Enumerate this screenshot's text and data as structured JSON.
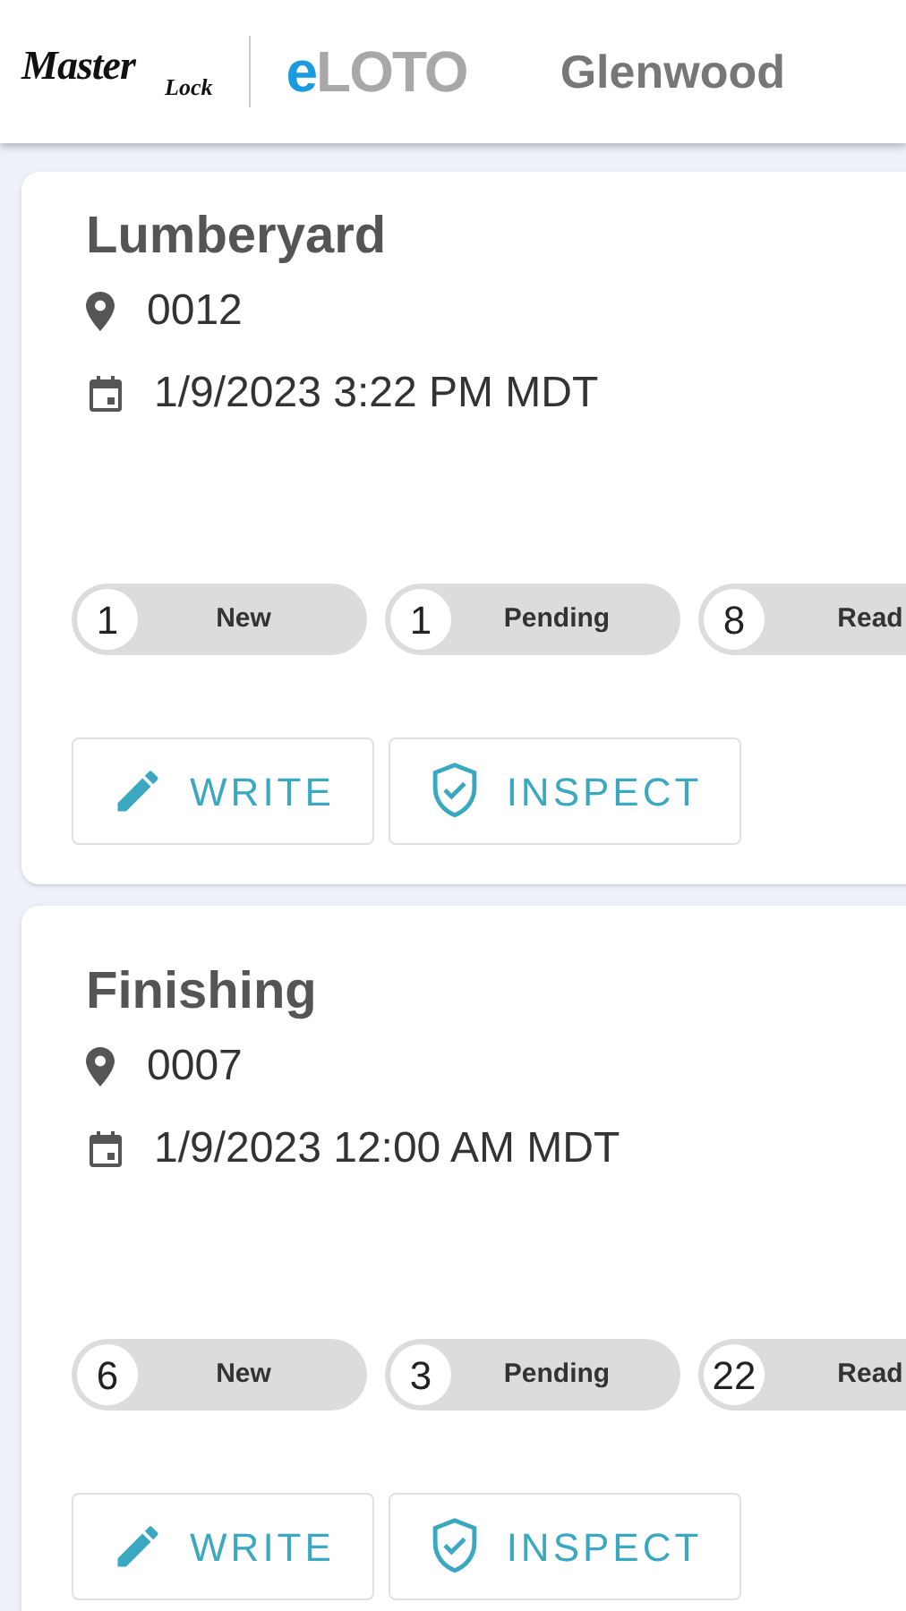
{
  "header": {
    "brand_top": "Master",
    "brand_bottom": "Lock",
    "app_prefix": "e",
    "app_name": "LOTO",
    "site": "Glenwood"
  },
  "cards": [
    {
      "title": "Lumberyard",
      "location": "0012",
      "date": "1/9/2023 3:22 PM MDT",
      "chips": [
        {
          "count": "1",
          "label": "New"
        },
        {
          "count": "1",
          "label": "Pending"
        },
        {
          "count": "8",
          "label": "Read"
        }
      ],
      "buttons": [
        {
          "kind": "write",
          "label": "WRITE"
        },
        {
          "kind": "inspect",
          "label": "INSPECT"
        }
      ]
    },
    {
      "title": "Finishing",
      "location": "0007",
      "date": "1/9/2023 12:00 AM MDT",
      "chips": [
        {
          "count": "6",
          "label": "New"
        },
        {
          "count": "3",
          "label": "Pending"
        },
        {
          "count": "22",
          "label": "Read"
        }
      ],
      "buttons": [
        {
          "kind": "write",
          "label": "WRITE"
        },
        {
          "kind": "inspect",
          "label": "INSPECT"
        }
      ]
    }
  ]
}
